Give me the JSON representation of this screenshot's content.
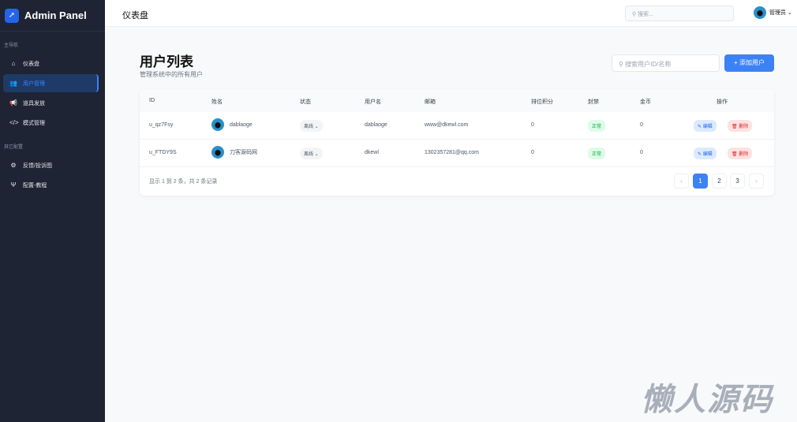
{
  "sidebar": {
    "app_title": "Admin Panel",
    "section1": "主导航",
    "section2": "其它配置",
    "items": [
      {
        "label": "仪表盘",
        "icon": "home-icon"
      },
      {
        "label": "用户管理",
        "icon": "users-icon"
      },
      {
        "label": "道具发放",
        "icon": "megaphone-icon"
      },
      {
        "label": "模式管理",
        "icon": "code-icon"
      },
      {
        "label": "反馈/投诉图",
        "icon": "gear-icon"
      },
      {
        "label": "配置-教程",
        "icon": "seedling-icon"
      }
    ]
  },
  "topbar": {
    "title": "仪表盘",
    "search_placeholder": "搜索...",
    "user": "管理员"
  },
  "page": {
    "title": "用户列表",
    "subtitle": "管理系统中的所有用户",
    "search_placeholder": "搜索用户ID/名称",
    "add_button": "+ 添加用户"
  },
  "table": {
    "headers": [
      "ID",
      "姓名",
      "状态",
      "用户名",
      "邮箱",
      "排位积分",
      "封禁",
      "金币",
      "操作"
    ],
    "rows": [
      {
        "id": "u_qz7Fsy",
        "name": "dablaoge",
        "status": "离线",
        "username": "dablaoge",
        "email": "www@dkewl.com",
        "score": "0",
        "ban": "正常",
        "coins": "0"
      },
      {
        "id": "u_FTDY9S",
        "name": "刀客源码网",
        "status": "离线",
        "username": "dkewl",
        "email": "1302357281@qq.com",
        "score": "0",
        "ban": "正常",
        "coins": "0"
      }
    ],
    "edit_label": "✎ 编辑",
    "delete_label": "🗑 删除",
    "footer": "显示 1 到 2 条，共 2 条记录",
    "pages": [
      "1",
      "2",
      "3"
    ],
    "current_page": "1"
  },
  "watermark": "懒人源码"
}
